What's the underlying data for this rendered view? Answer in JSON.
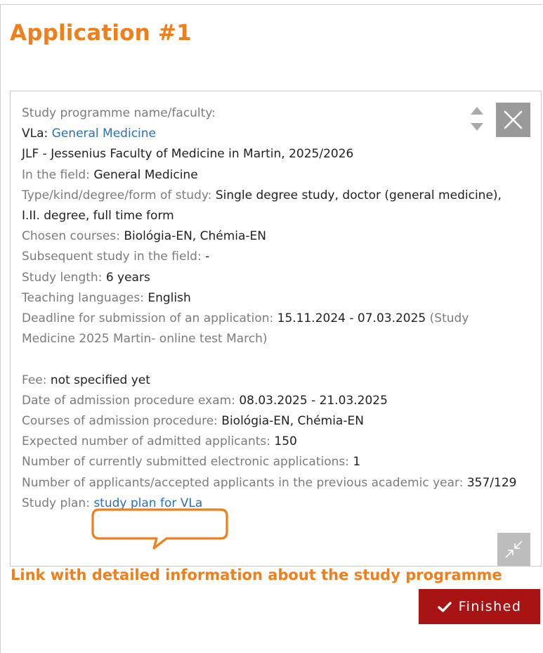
{
  "page": {
    "title": "Application #1",
    "annotation": "Link with detailed information about the study programme"
  },
  "details": {
    "programme_label": "Study programme name/faculty:",
    "programme_code": "VLa: ",
    "programme_name": "General Medicine",
    "faculty": "JLF - Jessenius Faculty of Medicine in Martin, 2025/2026",
    "field_label": "In the field: ",
    "field_value": "General Medicine",
    "type_label": "Type/kind/degree/form of study: ",
    "type_value": "Single degree study, doctor (general medicine), I.II. degree, full time form",
    "courses_label": "Chosen courses: ",
    "courses_value": "Biológia-EN, Chémia-EN",
    "subsequent_label": "Subsequent study in the field: ",
    "subsequent_value": "-",
    "length_label": "Study length: ",
    "length_value": "6 years",
    "languages_label": "Teaching languages: ",
    "languages_value": "English",
    "deadline_label": "Deadline for submission of an application: ",
    "deadline_value": "15.11.2024 - 07.03.2025",
    "deadline_note": " (Study Medicine 2025 Martin- online test March)",
    "fee_label": "Fee: ",
    "fee_value": "not specified yet",
    "exam_date_label": "Date of admission procedure exam: ",
    "exam_date_value": "08.03.2025 - 21.03.2025",
    "admission_courses_label": "Courses of admission procedure: ",
    "admission_courses_value": "Biológia-EN, Chémia-EN",
    "expected_label": "Expected number of admitted applicants: ",
    "expected_value": "150",
    "submitted_label": "Number of currently submitted electronic applications: ",
    "submitted_value": "1",
    "previous_label": "Number of applicants/accepted applicants in the previous academic year: ",
    "previous_value": "357/129",
    "study_plan_label": "Study plan: ",
    "study_plan_link": "study plan for VLa"
  },
  "buttons": {
    "finished": "Finished"
  },
  "icons": {
    "sort": "sort-arrows-icon",
    "close": "close-icon",
    "collapse": "collapse-icon",
    "check": "check-icon"
  },
  "colors": {
    "accent_orange": "#f07e1b",
    "link_blue": "#2a6fb8",
    "finished_red": "#a81313",
    "label_gray": "#7b7b7b"
  }
}
